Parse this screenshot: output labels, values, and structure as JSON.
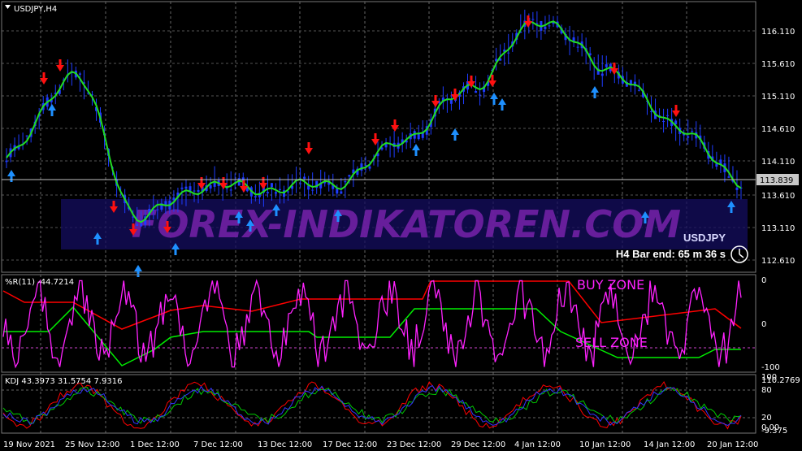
{
  "window": {
    "title": "USDJPY,H4"
  },
  "main_panel": {
    "price_labels": [
      "116.110",
      "115.610",
      "115.110",
      "114.610",
      "114.110",
      "113.610",
      "113.110",
      "112.610"
    ],
    "current_price": "113.839",
    "watermark": "FOREX-INDIKATOREN.COM",
    "info_symbol": "USDJPY",
    "info_bar_end": "H4 Bar end: 65 m 36 s"
  },
  "wr_panel": {
    "header": "%R(11) -44.7214",
    "levels": [
      "0",
      "0",
      "-100"
    ],
    "buy_zone": "BUY ZONE",
    "sell_zone": "SELL ZONE"
  },
  "kdj_panel": {
    "header": "KDJ 43.3973 31.5754 7.9316",
    "levels": [
      "110.2769",
      "100",
      "80",
      "20",
      "0.00",
      "-9.375"
    ]
  },
  "time_axis": [
    "19 Nov 2021",
    "25 Nov 12:00",
    "1 Dec 12:00",
    "7 Dec 12:00",
    "13 Dec 12:00",
    "17 Dec 12:00",
    "23 Dec 12:00",
    "29 Dec 12:00",
    "4 Jan 12:00",
    "10 Jan 12:00",
    "14 Jan 12:00",
    "20 Jan 12:00"
  ],
  "colors": {
    "background": "#000000",
    "candles": "#1e3cff",
    "ma_line": "#22dd22",
    "up_arrow": "#1e90ff",
    "down_arrow": "#ff1010",
    "wr_line": "#ff22ff",
    "red_line": "#ff0000",
    "green_line": "#00ee00",
    "kdj_k": "#3333ff",
    "kdj_d": "#00cc00",
    "kdj_j": "#ff0000",
    "watermark": "#7722aa"
  },
  "chart_data": {
    "type": "line",
    "symbol": "USDJPY",
    "timeframe": "H4",
    "x": [
      "19 Nov 2021",
      "25 Nov 12:00",
      "1 Dec 12:00",
      "7 Dec 12:00",
      "13 Dec 12:00",
      "17 Dec 12:00",
      "23 Dec 12:00",
      "29 Dec 12:00",
      "4 Jan 12:00",
      "10 Jan 12:00",
      "14 Jan 12:00",
      "20 Jan 12:00"
    ],
    "series": [
      {
        "values": [
          114.1,
          115.3,
          113.25,
          113.7,
          113.65,
          113.75,
          114.4,
          115.15,
          116.1,
          115.4,
          114.6,
          113.75
        ]
      }
    ],
    "ylim": [
      112.45,
      116.35
    ],
    "current": 113.839
  }
}
